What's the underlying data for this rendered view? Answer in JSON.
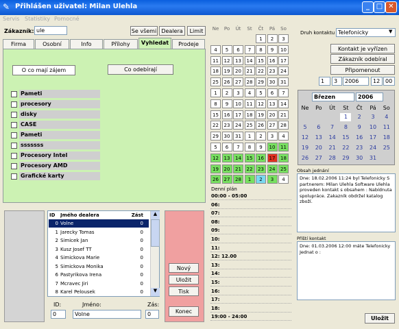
{
  "window": {
    "title": "Přihlášen uživatel: Milan Ulehla"
  },
  "menu": [
    "Servis",
    "Statistiky",
    "Pomocné"
  ],
  "customer": {
    "label": "Zákazník:",
    "value": "ule",
    "btn_all": "Se všemi",
    "btn_dealer": "Dealera",
    "btn_limit": "Limit"
  },
  "tabs": [
    "Firma",
    "Osobní",
    "Info",
    "Přílohy",
    "Vyhledat",
    "Prodeje"
  ],
  "search": {
    "btn_interest": "O co mají zájem",
    "btn_buy": "Co odebírají",
    "items": [
      "Pameti",
      "procesory",
      "disky",
      "CASE",
      "Pameti",
      "sssssss",
      "Procesory Intel",
      "Procesory AMD",
      "Grafické karty"
    ]
  },
  "table": {
    "headers": [
      "ID",
      "Jmého dealera",
      "Zást"
    ],
    "rows": [
      [
        "0",
        "Volne",
        "0"
      ],
      [
        "1",
        "Jarecky Tomas",
        "0"
      ],
      [
        "2",
        "Simicek Jan",
        "0"
      ],
      [
        "3",
        "Kusz Josef   TT",
        "0"
      ],
      [
        "4",
        "Simickova Marie",
        "0"
      ],
      [
        "5",
        "Simickova Monika",
        "0"
      ],
      [
        "6",
        "Pastyrikova Irena",
        "0"
      ],
      [
        "7",
        "Mcravec Jiri",
        "0"
      ],
      [
        "8",
        "Karel Pelousek",
        "0"
      ]
    ],
    "id_label": "ID:",
    "id_value": "0",
    "name_label": "Jméno:",
    "name_value": "Volne",
    "zas_label": "Zás:",
    "zas_value": "0"
  },
  "actions": {
    "new": "Nový",
    "save": "Uložit",
    "print": "Tisk",
    "end": "Konec"
  },
  "mini_cal": {
    "headers": [
      "Ne",
      "Po",
      "Út",
      "St",
      "Čt",
      "Pá",
      "So"
    ],
    "cells": [
      "",
      "",
      "",
      "",
      "1",
      "2",
      "3",
      "4",
      "5",
      "6",
      "7",
      "8",
      "9",
      "10",
      "11",
      "12",
      "13",
      "14",
      "15",
      "16",
      "17",
      "18",
      "19",
      "20",
      "21",
      "22",
      "23",
      "24",
      "25",
      "26",
      "27",
      "28",
      "29",
      "30",
      "31",
      "1",
      "2",
      "3",
      "4",
      "5",
      "6",
      "7",
      "8",
      "9",
      "10",
      "11",
      "12",
      "13",
      "14",
      "15",
      "16",
      "17",
      "18",
      "19",
      "20",
      "21",
      "22",
      "23",
      "24",
      "25",
      "26",
      "27",
      "28",
      "29",
      "30",
      "31",
      "1",
      "2",
      "3",
      "4",
      "5",
      "6",
      "7",
      "8",
      "9",
      "10",
      "11",
      "12",
      "13",
      "14",
      "15",
      "16",
      "17",
      "18",
      "19",
      "20",
      "21",
      "22",
      "23",
      "24",
      "25",
      "26",
      "27",
      "28",
      "1",
      "2",
      "3",
      "4"
    ]
  },
  "schedule": {
    "label": "Denní plán",
    "rows": [
      "00:00 - 05:00",
      "06:",
      "07:",
      "08:",
      "09:",
      "10:",
      "11:",
      "12: 12.00",
      "13:",
      "14:",
      "15:",
      "16:",
      "17:",
      "18:",
      "19:00 - 24:00"
    ]
  },
  "contact": {
    "type_label": "Druh kontaktu",
    "type_value": "Telefonicky",
    "btn_done": "Kontakt je vyřízen",
    "btn_bought": "Zákazník odebíral",
    "btn_remind": "Připomenout",
    "day": "1",
    "month": "3",
    "year": "2006",
    "hour": "12",
    "minute": "00"
  },
  "big_cal": {
    "month": "Březen",
    "year": "2006",
    "headers": [
      "Ne",
      "Po",
      "Út",
      "St",
      "Čt",
      "Pá",
      "So"
    ],
    "cells": [
      "",
      "",
      "",
      "1",
      "2",
      "3",
      "4",
      "5",
      "6",
      "7",
      "8",
      "9",
      "10",
      "11",
      "12",
      "13",
      "14",
      "15",
      "16",
      "17",
      "18",
      "19",
      "20",
      "21",
      "22",
      "23",
      "24",
      "25",
      "26",
      "27",
      "28",
      "29",
      "30",
      "31",
      ""
    ]
  },
  "notes": {
    "label1": "Obsah jednání",
    "text1": "Dne: 18.02.2006 11:24 byl Telefonicky S partnerem: Milan Ulehla Software Ulehla proveden kontakt s obsahem : Nabídnuta spolupráce. Zakazník obdržel katalog zboží.",
    "label2": "Příští kontakt",
    "text2": "Dne: 01.03.2006 12:00 máte Telefonicky Jednat o :",
    "save": "Uložit"
  }
}
